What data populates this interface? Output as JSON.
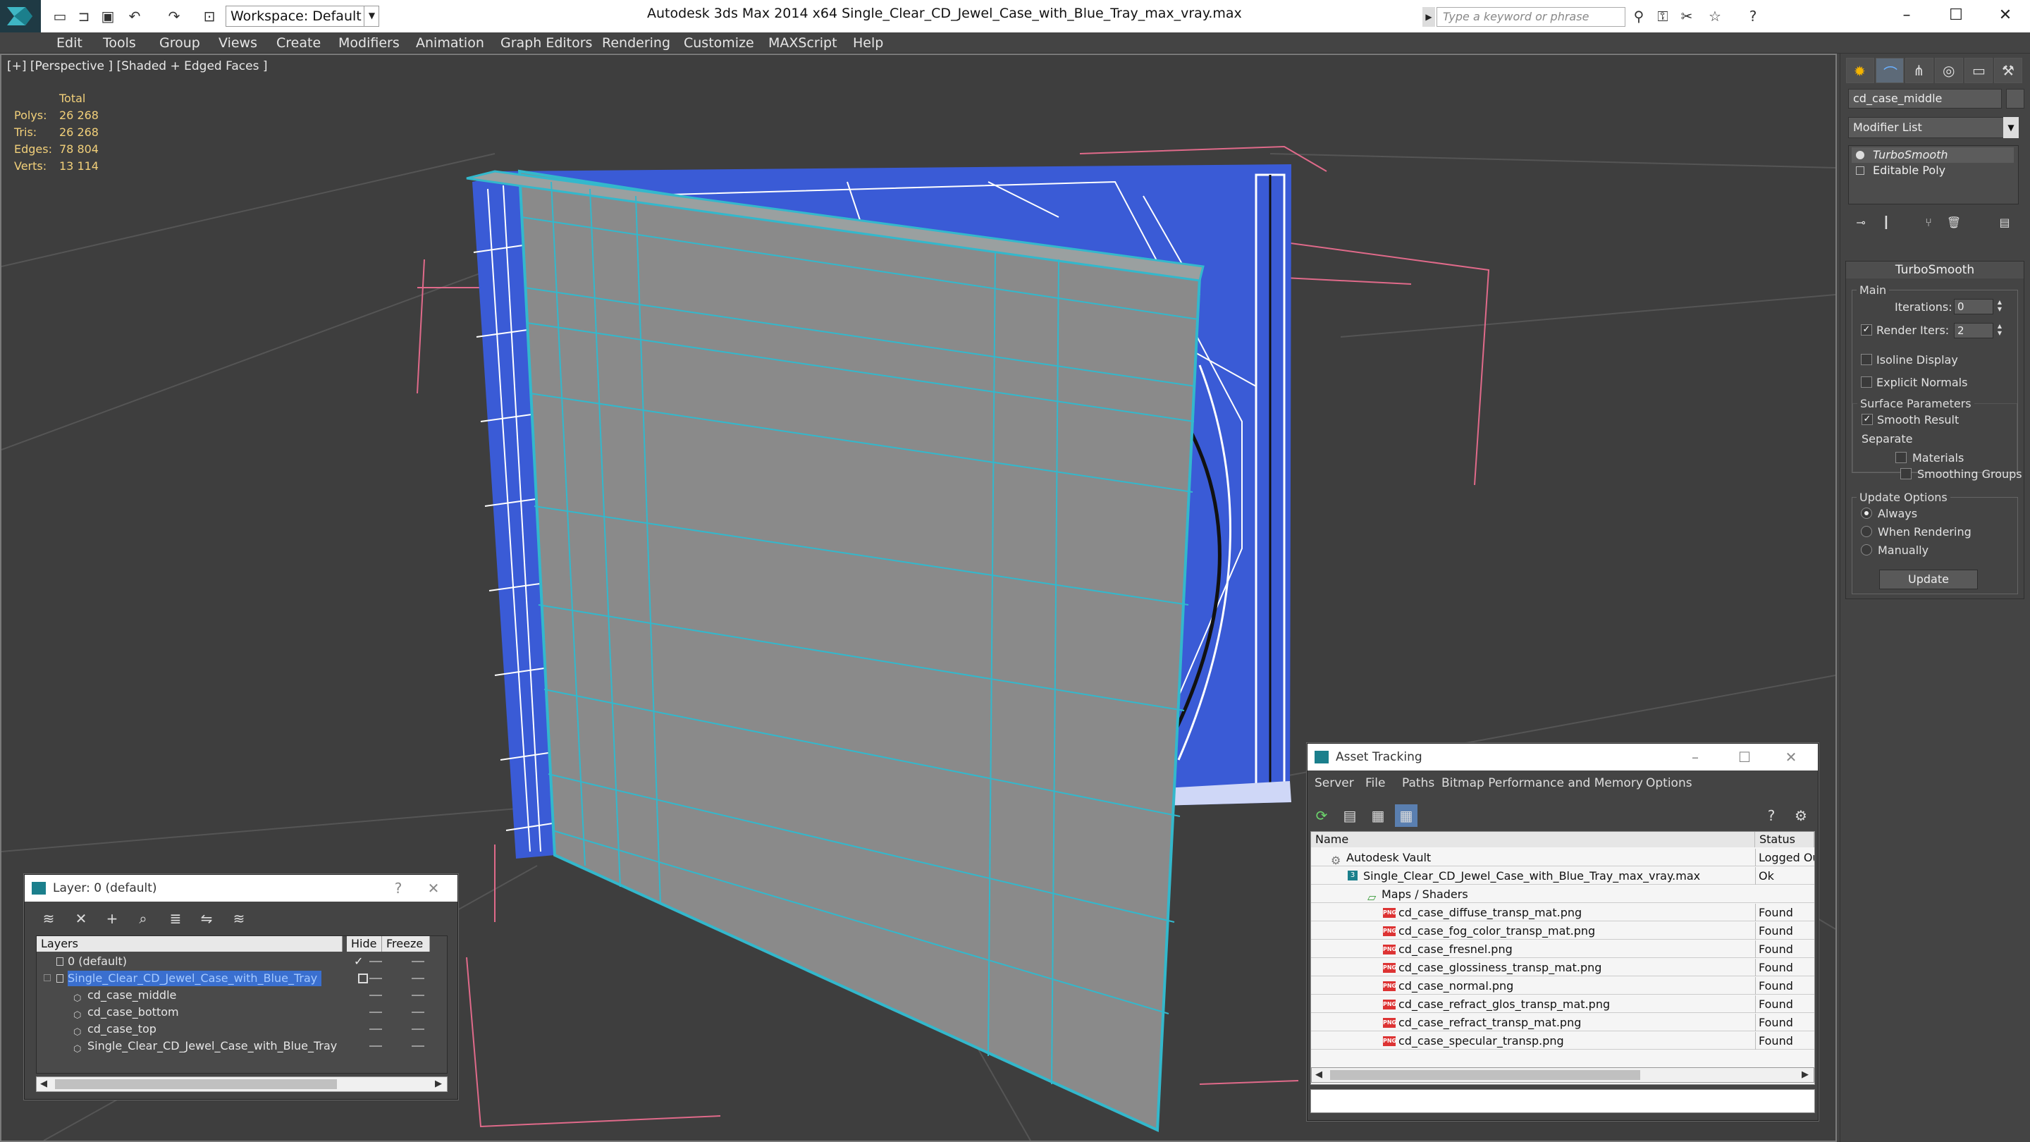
{
  "titlebar": {
    "workspace": "Workspace: Default",
    "app_title": "Autodesk 3ds Max  2014 x64     Single_Clear_CD_Jewel_Case_with_Blue_Tray_max_vray.max",
    "search_placeholder": "Type a keyword or phrase"
  },
  "menu": [
    "Edit",
    "Tools",
    "Group",
    "Views",
    "Create",
    "Modifiers",
    "Animation",
    "Graph Editors",
    "Rendering",
    "Customize",
    "MAXScript",
    "Help"
  ],
  "viewport": {
    "label": "[+] [Perspective ] [Shaded + Edged Faces ]",
    "stats": {
      "header": "Total",
      "rows": [
        {
          "key": "Polys:",
          "value": "26 268"
        },
        {
          "key": "Tris:",
          "value": "26 268"
        },
        {
          "key": "Edges:",
          "value": "78 804"
        },
        {
          "key": "Verts:",
          "value": "13 114"
        }
      ]
    },
    "model_colors": {
      "panel": "#8a8a8a",
      "edges": "#33b8cc",
      "tray": "#3a5bd6"
    }
  },
  "command_panel": {
    "object_name": "cd_case_middle",
    "modifier_list": "Modifier List",
    "stack": [
      "TurboSmooth",
      "Editable Poly"
    ],
    "turbosmooth": {
      "title": "TurboSmooth",
      "main": "Main",
      "iterations_label": "Iterations:",
      "iterations_value": "0",
      "render_iters_label": "Render Iters:",
      "render_iters_value": "2",
      "isoline": "Isoline Display",
      "explicit_normals": "Explicit Normals",
      "surface_params": "Surface Parameters",
      "smooth_result": "Smooth Result",
      "separate": "Separate",
      "materials": "Materials",
      "smoothing_groups": "Smoothing Groups",
      "update_options": "Update Options",
      "always": "Always",
      "when_rendering": "When Rendering",
      "manually": "Manually",
      "update_btn": "Update"
    }
  },
  "layer_dialog": {
    "title": "Layer: 0 (default)",
    "help": "?",
    "close": "✕",
    "col_layers": "Layers",
    "col_hide": "Hide",
    "col_freeze": "Freeze",
    "rows": [
      {
        "name": "0 (default)",
        "indent": 0,
        "selected": false
      },
      {
        "name": "Single_Clear_CD_Jewel_Case_with_Blue_Tray",
        "indent": 0,
        "selected": true
      },
      {
        "name": "cd_case_middle",
        "indent": 1,
        "selected": false
      },
      {
        "name": "cd_case_bottom",
        "indent": 1,
        "selected": false
      },
      {
        "name": "cd_case_top",
        "indent": 1,
        "selected": false
      },
      {
        "name": "Single_Clear_CD_Jewel_Case_with_Blue_Tray",
        "indent": 1,
        "selected": false
      }
    ]
  },
  "asset_dialog": {
    "title": "Asset Tracking",
    "menu": [
      "Server",
      "File",
      "Paths",
      "Bitmap Performance and Memory",
      "Options"
    ],
    "col_name": "Name",
    "col_status": "Status",
    "rows": [
      {
        "name": "Autodesk Vault",
        "status": "Logged Out",
        "indent": 0,
        "icon": "vault"
      },
      {
        "name": "Single_Clear_CD_Jewel_Case_with_Blue_Tray_max_vray.max",
        "status": "Ok",
        "indent": 1,
        "icon": "max"
      },
      {
        "name": "Maps / Shaders",
        "status": "",
        "indent": 2,
        "icon": "maps"
      },
      {
        "name": "cd_case_diffuse_transp_mat.png",
        "status": "Found",
        "indent": 3,
        "icon": "png"
      },
      {
        "name": "cd_case_fog_color_transp_mat.png",
        "status": "Found",
        "indent": 3,
        "icon": "png"
      },
      {
        "name": "cd_case_fresnel.png",
        "status": "Found",
        "indent": 3,
        "icon": "png"
      },
      {
        "name": "cd_case_glossiness_transp_mat.png",
        "status": "Found",
        "indent": 3,
        "icon": "png"
      },
      {
        "name": "cd_case_normal.png",
        "status": "Found",
        "indent": 3,
        "icon": "png"
      },
      {
        "name": "cd_case_refract_glos_transp_mat.png",
        "status": "Found",
        "indent": 3,
        "icon": "png"
      },
      {
        "name": "cd_case_refract_transp_mat.png",
        "status": "Found",
        "indent": 3,
        "icon": "png"
      },
      {
        "name": "cd_case_specular_transp.png",
        "status": "Found",
        "indent": 3,
        "icon": "png"
      }
    ]
  }
}
